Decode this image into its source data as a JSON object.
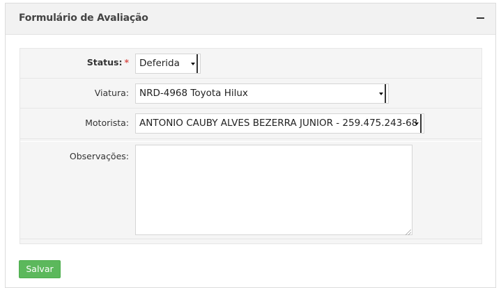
{
  "panel": {
    "title": "Formulário de Avaliação",
    "collapse_icon": "minus-icon"
  },
  "form": {
    "status": {
      "label": "Status:",
      "required_mark": "*",
      "selected": "Deferida"
    },
    "viatura": {
      "label": "Viatura:",
      "selected": "NRD-4968 Toyota Hilux"
    },
    "motorista": {
      "label": "Motorista:",
      "selected": "ANTONIO CAUBY ALVES BEZERRA JUNIOR - 259.475.243-68"
    },
    "observacoes": {
      "label": "Observações:",
      "value": ""
    }
  },
  "actions": {
    "save_label": "Salvar"
  },
  "colors": {
    "save_button": "#5cb85c",
    "required_mark": "#d9534f",
    "header_bg": "#f2f2f2"
  }
}
